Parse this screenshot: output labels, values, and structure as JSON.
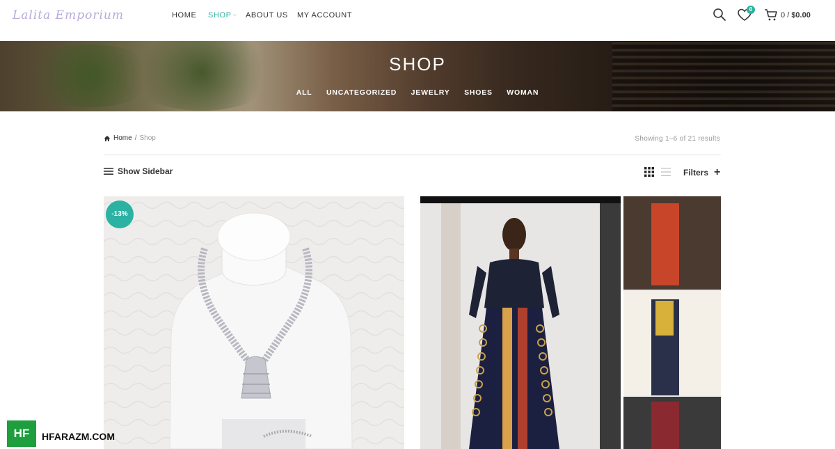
{
  "logo": {
    "text": "Lalita Emporium"
  },
  "nav": {
    "items": [
      {
        "label": "HOME"
      },
      {
        "label": "SHOP"
      },
      {
        "label": "ABOUT US"
      },
      {
        "label": "MY ACCOUNT"
      }
    ]
  },
  "header": {
    "wishlist_count": "0",
    "cart_count": "0",
    "cart_separator": "/",
    "cart_total": "$0.00"
  },
  "hero": {
    "title": "SHOP",
    "categories": [
      "ALL",
      "UNCATEGORIZED",
      "JEWELRY",
      "SHOES",
      "WOMAN"
    ]
  },
  "breadcrumb": {
    "home": "Home",
    "separator": "/",
    "current": "Shop"
  },
  "results": "Showing 1–6 of 21 results",
  "toolbar": {
    "show_sidebar": "Show Sidebar",
    "filters": "Filters",
    "filters_plus": "+"
  },
  "products": [
    {
      "badge": "-13%"
    },
    {
      "badge": ""
    }
  ],
  "watermark": {
    "box": "HF",
    "text": "HFARAZM.COM"
  },
  "colors": {
    "accent": "#2bb2a3",
    "text": "#333333",
    "muted": "#999999"
  }
}
